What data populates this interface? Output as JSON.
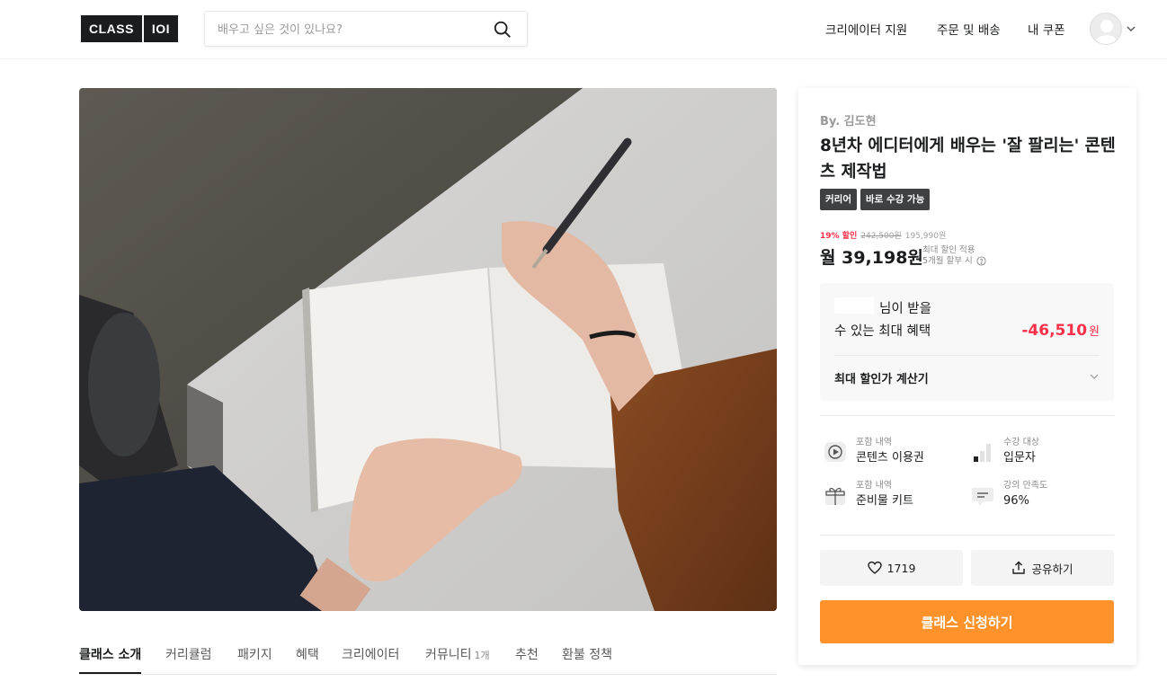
{
  "header": {
    "logo_left": "CLASS",
    "logo_right": "IOI",
    "search_placeholder": "배우고 싶은 것이 있나요?",
    "nav": [
      "크리에이터 지원",
      "주문 및 배송",
      "내 쿠폰"
    ]
  },
  "tabs": [
    {
      "label": "클래스 소개",
      "count": ""
    },
    {
      "label": "커리큘럼",
      "count": ""
    },
    {
      "label": "패키지",
      "count": ""
    },
    {
      "label": "혜택",
      "count": ""
    },
    {
      "label": "크리에이터",
      "count": ""
    },
    {
      "label": "커뮤니티",
      "count": "1개"
    },
    {
      "label": "추천",
      "count": ""
    },
    {
      "label": "환불 정책",
      "count": ""
    }
  ],
  "card": {
    "by": "By. 김도현",
    "title": "8년차 에디터에게 배우는 '잘 팔리는' 콘텐츠 제작법",
    "tags": [
      "커리어",
      "바로 수강 가능"
    ],
    "discount_pct": "19% 할인",
    "original_price": "242,500원",
    "sale_price": "195,990원",
    "monthly_price": "월 39,198원",
    "price_note_1": "최대 할인 적용",
    "price_note_2": "5개월 할부 시",
    "benefit_line1": "님이 받을",
    "benefit_line2": "수 있는 최대 혜택",
    "benefit_amount": "-46,510",
    "benefit_unit": "원",
    "calculator": "최대 할인가 계산기",
    "info": [
      {
        "label": "포함 내역",
        "value": "콘텐츠 이용권",
        "icon": "play-icon"
      },
      {
        "label": "수강 대상",
        "value": "입문자",
        "icon": "level-bars-icon"
      },
      {
        "label": "포함 내역",
        "value": "준비물 키트",
        "icon": "gift-icon"
      },
      {
        "label": "강의 만족도",
        "value": "96%",
        "icon": "comment-icon"
      }
    ],
    "likes": "1719",
    "share": "공유하기",
    "apply": "클래스 신청하기"
  },
  "colors": {
    "accent": "#ff922b",
    "discount": "#fd3049",
    "dark": "#1b1c1d"
  }
}
